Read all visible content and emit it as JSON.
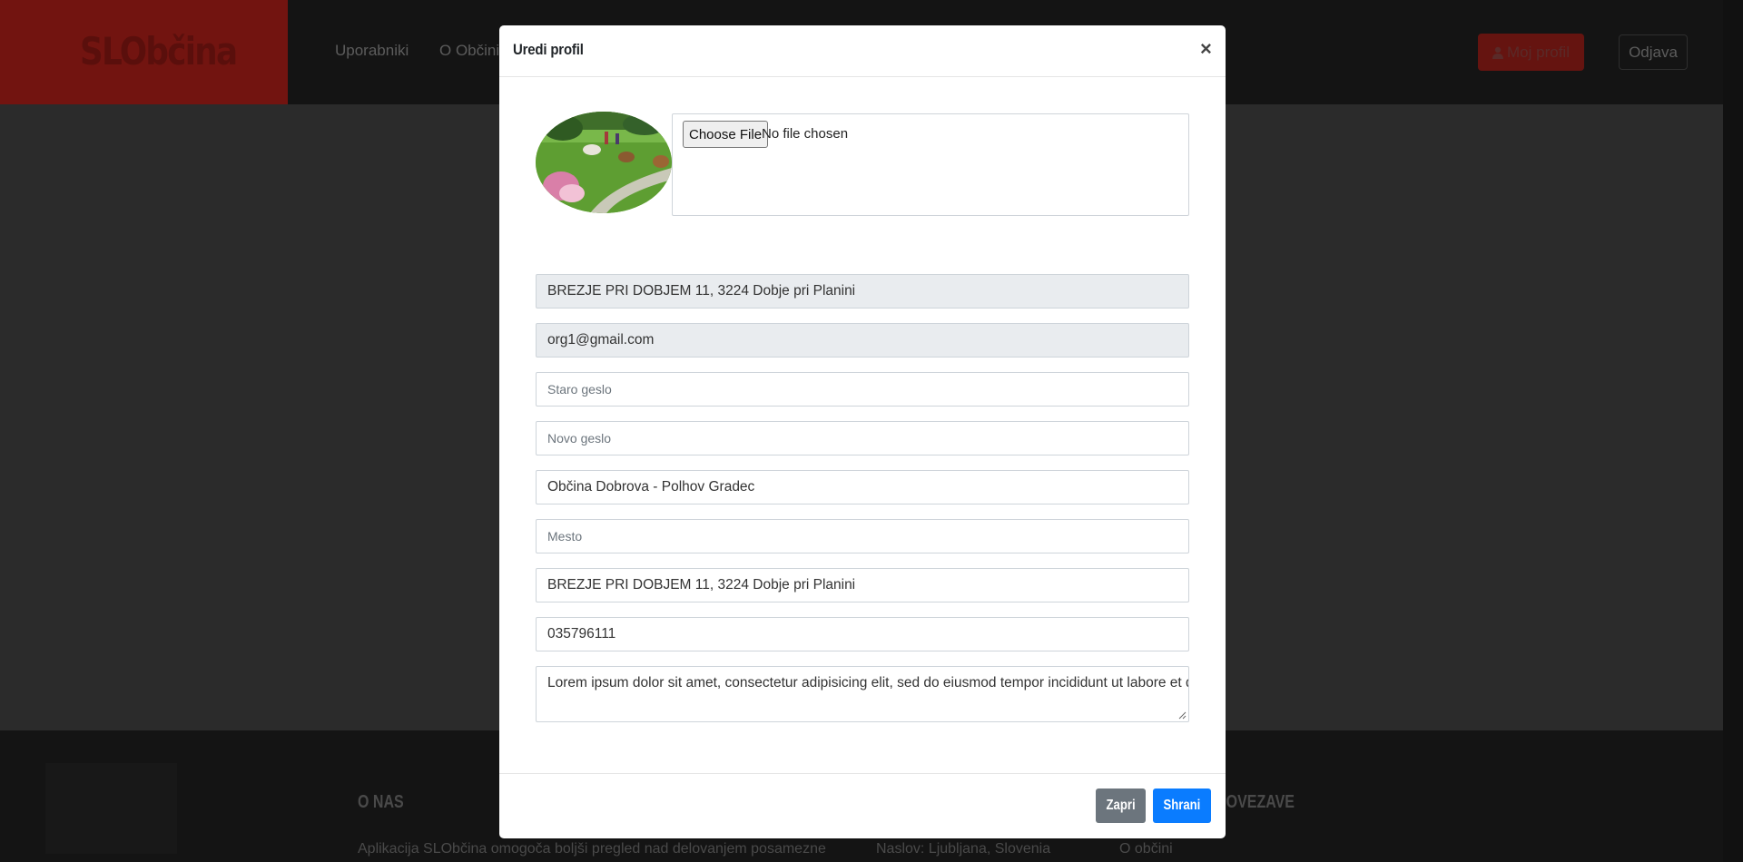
{
  "navbar": {
    "brand": "SLObčina",
    "links": [
      "Uporabniki",
      "O Občini"
    ],
    "profile_label": "Moj profil",
    "logout_label": "Odjava"
  },
  "footer": {
    "about_heading": "O NAS",
    "about_text": "Aplikacija SLObčina omogoča boljši pregled nad delovanjem posamezne",
    "address_text": "Naslov: Ljubljana, Slovenia",
    "links_heading": "POVEZAVE",
    "links_first": "O občini"
  },
  "modal": {
    "title": "Uredi profil",
    "close_symbol": "×",
    "file_button": "Choose File",
    "file_status": "No file chosen",
    "fields": {
      "address_readonly": "BREZJE PRI DOBJEM 11, 3224 Dobje pri Planini",
      "email_readonly": "org1@gmail.com",
      "old_password_placeholder": "Staro geslo",
      "new_password_placeholder": "Novo geslo",
      "name": "Občina Dobrova - Polhov Gradec",
      "city_placeholder": "Mesto",
      "address": "BREZJE PRI DOBJEM 11, 3224 Dobje pri Planini",
      "phone": "035796111",
      "description": "Lorem ipsum dolor sit amet, consectetur adipisicing elit, sed do eiusmod tempor incididunt ut labore et dolore magna."
    },
    "close_button": "Zapri",
    "save_button": "Shrani"
  },
  "colors": {
    "brand_red": "#721410",
    "primary": "#0a7cff",
    "secondary": "#6c757d"
  }
}
